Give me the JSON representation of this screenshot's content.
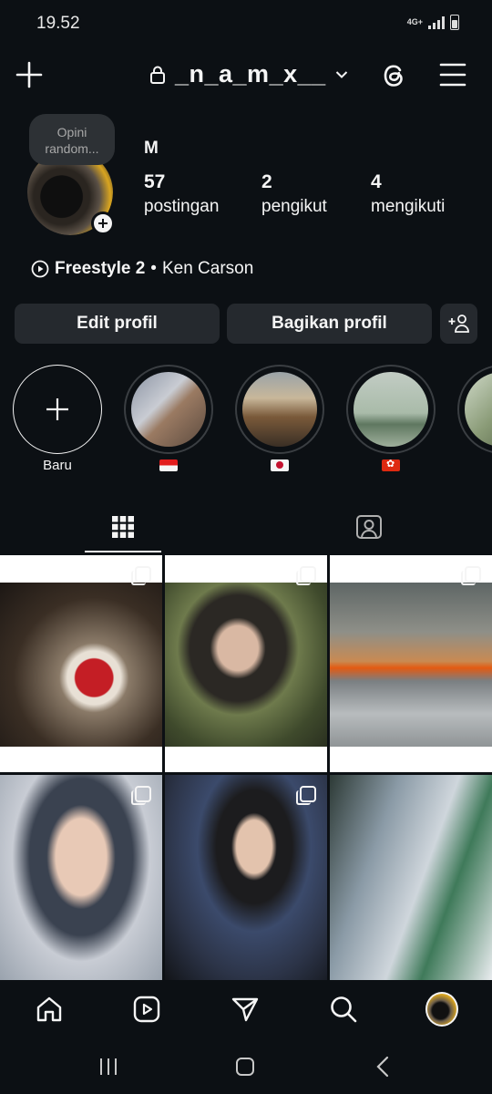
{
  "status": {
    "time": "19.52",
    "network": "4G+"
  },
  "header": {
    "username": "_n_a_m_x__"
  },
  "profile": {
    "note": "Opini random...",
    "display_name": "M",
    "stats": [
      {
        "value": "57",
        "label": "postingan"
      },
      {
        "value": "2",
        "label": "pengikut"
      },
      {
        "value": "4",
        "label": "mengikuti"
      }
    ],
    "music": {
      "song": "Freestyle 2",
      "separator": "•",
      "artist": "Ken Carson"
    }
  },
  "buttons": {
    "edit": "Edit profil",
    "share": "Bagikan profil"
  },
  "highlights": {
    "new_label": "Baru"
  },
  "colors": {
    "background": "#0c1014",
    "button": "#25292e",
    "text": "#f5f5f5"
  }
}
